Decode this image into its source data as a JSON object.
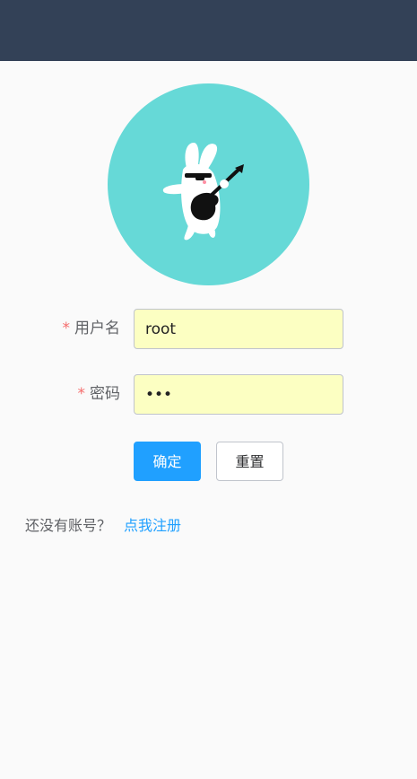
{
  "colors": {
    "topbar": "#334157",
    "avatar_background": "#66d9d7",
    "primary": "#20a0ff",
    "required_star": "#f56c6c",
    "input_autofill": "#fcffc2"
  },
  "avatar": {
    "icon": "rocking-bunny-guitar-icon"
  },
  "form": {
    "username": {
      "required_mark": "*",
      "label": "用户名",
      "value": "root"
    },
    "password": {
      "required_mark": "*",
      "label": "密码",
      "value": "•••"
    }
  },
  "buttons": {
    "confirm_label": "确定",
    "reset_label": "重置"
  },
  "register": {
    "prompt": "还没有账号？",
    "link_label": "点我注册"
  }
}
